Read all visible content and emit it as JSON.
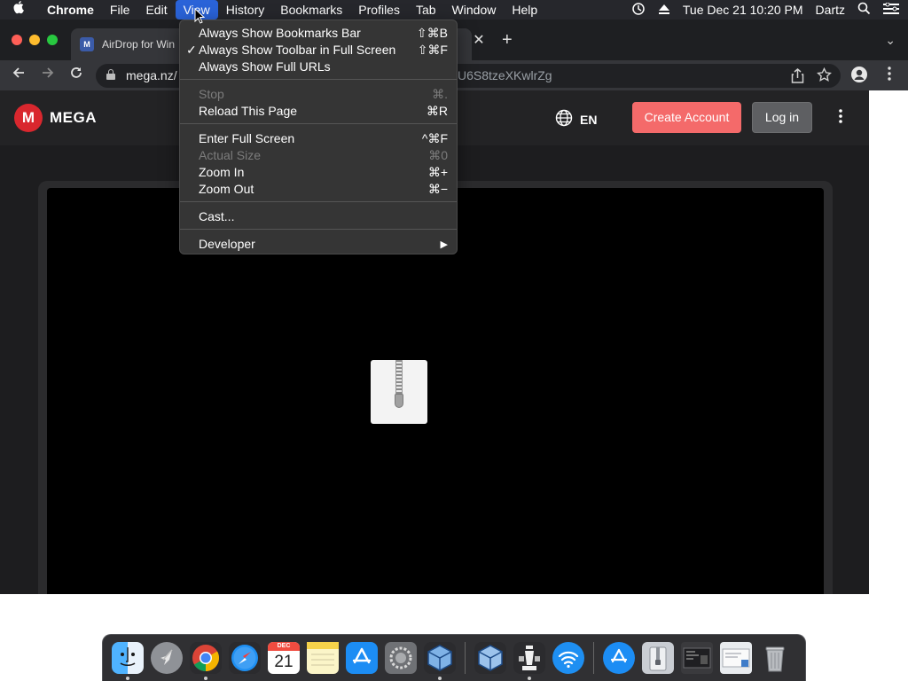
{
  "menubar": {
    "apple": "",
    "items": [
      "Chrome",
      "File",
      "Edit",
      "View",
      "History",
      "Bookmarks",
      "Profiles",
      "Tab",
      "Window",
      "Help"
    ],
    "active_item": "View",
    "time_machine_icon": "time-machine-icon",
    "eject_icon": "eject-icon",
    "clock": "Tue Dec 21  10:20 PM",
    "user": "Dartz",
    "search_icon": "spotlight-search-icon",
    "control_icon": "control-center-icon"
  },
  "browser": {
    "tab_title": "AirDrop for Win",
    "url_host": "mega.nz/",
    "url_tail": "U6S8tzeXKwlrZg"
  },
  "view_menu": {
    "items": [
      {
        "label": "Always Show Bookmarks Bar",
        "shortcut": "⇧⌘B",
        "checked": false,
        "disabled": false
      },
      {
        "label": "Always Show Toolbar in Full Screen",
        "shortcut": "⇧⌘F",
        "checked": true,
        "disabled": false
      },
      {
        "label": "Always Show Full URLs",
        "shortcut": "",
        "checked": false,
        "disabled": false
      },
      {
        "label": "Stop",
        "shortcut": "⌘.",
        "checked": false,
        "disabled": true
      },
      {
        "label": "Reload This Page",
        "shortcut": "⌘R",
        "checked": false,
        "disabled": false
      },
      {
        "label": "Enter Full Screen",
        "shortcut": "^⌘F",
        "checked": false,
        "disabled": false
      },
      {
        "label": "Actual Size",
        "shortcut": "⌘0",
        "checked": false,
        "disabled": true
      },
      {
        "label": "Zoom In",
        "shortcut": "⌘+",
        "checked": false,
        "disabled": false
      },
      {
        "label": "Zoom Out",
        "shortcut": "⌘−",
        "checked": false,
        "disabled": false
      },
      {
        "label": "Cast...",
        "shortcut": "",
        "checked": false,
        "disabled": false
      },
      {
        "label": "Developer",
        "shortcut": "▶",
        "checked": false,
        "disabled": false
      }
    ]
  },
  "mega": {
    "logo_letter": "M",
    "brand": "MEGA",
    "language": "EN",
    "create_account": "Create Account",
    "login": "Log in"
  },
  "dock": {
    "apps": [
      "Finder",
      "Launchpad",
      "Google Chrome",
      "Safari",
      "Calendar",
      "Notes",
      "App Store",
      "System Preferences",
      "VirtualBox",
      "VirtualBox VM",
      "Chess",
      "Wi-Fi",
      "App Store",
      "Archive",
      "Screenshot",
      "Preview",
      "Trash"
    ],
    "calendar_month": "DEC",
    "calendar_day": "21"
  },
  "colors": {
    "menu_highlight": "#2a63d8",
    "mega_red": "#d9272e",
    "create_button": "#f46a6a",
    "login_button": "#5e5f62"
  }
}
